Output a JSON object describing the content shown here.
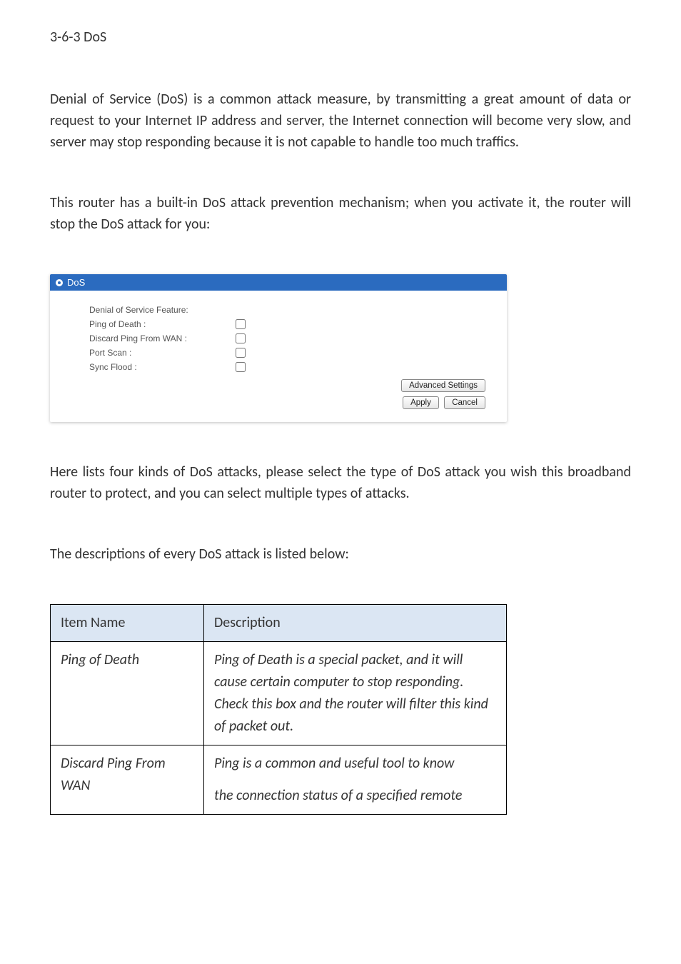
{
  "section_heading": "3-6-3 DoS",
  "paragraphs": {
    "p1": "Denial of Service (DoS) is a common attack measure, by transmitting a great amount of data or request to your Internet IP address and server, the Internet connection will become very slow, and server may stop responding because it is not capable to handle too much traffics.",
    "p2": "This router has a built-in DoS attack prevention mechanism; when you activate it, the router will stop the DoS attack for you:",
    "p3": "Here lists four kinds of DoS attacks, please select the type of DoS attack you wish this broadband router to protect, and you can select multiple types of attacks.",
    "p4": "The descriptions of every DoS attack is listed below:"
  },
  "panel": {
    "title": "DoS",
    "fields": {
      "feature_label": "Denial of Service Feature:",
      "ping_of_death_label": "Ping of Death :",
      "discard_ping_label": "Discard Ping From WAN :",
      "port_scan_label": "Port Scan :",
      "sync_flood_label": "Sync Flood :"
    },
    "buttons": {
      "advanced": "Advanced Settings",
      "apply": "Apply",
      "cancel": "Cancel"
    }
  },
  "table": {
    "headers": {
      "item_name": "Item Name",
      "description": "Description"
    },
    "rows": [
      {
        "name": "Ping of Death",
        "desc": "Ping of Death is a special packet, and it will cause certain computer to stop responding. Check this box and the router will filter this kind of packet out."
      },
      {
        "name": "Discard Ping From WAN",
        "desc_line1": "Ping is a common and useful tool to know",
        "desc_line2": "the connection status of a specified remote"
      }
    ]
  }
}
